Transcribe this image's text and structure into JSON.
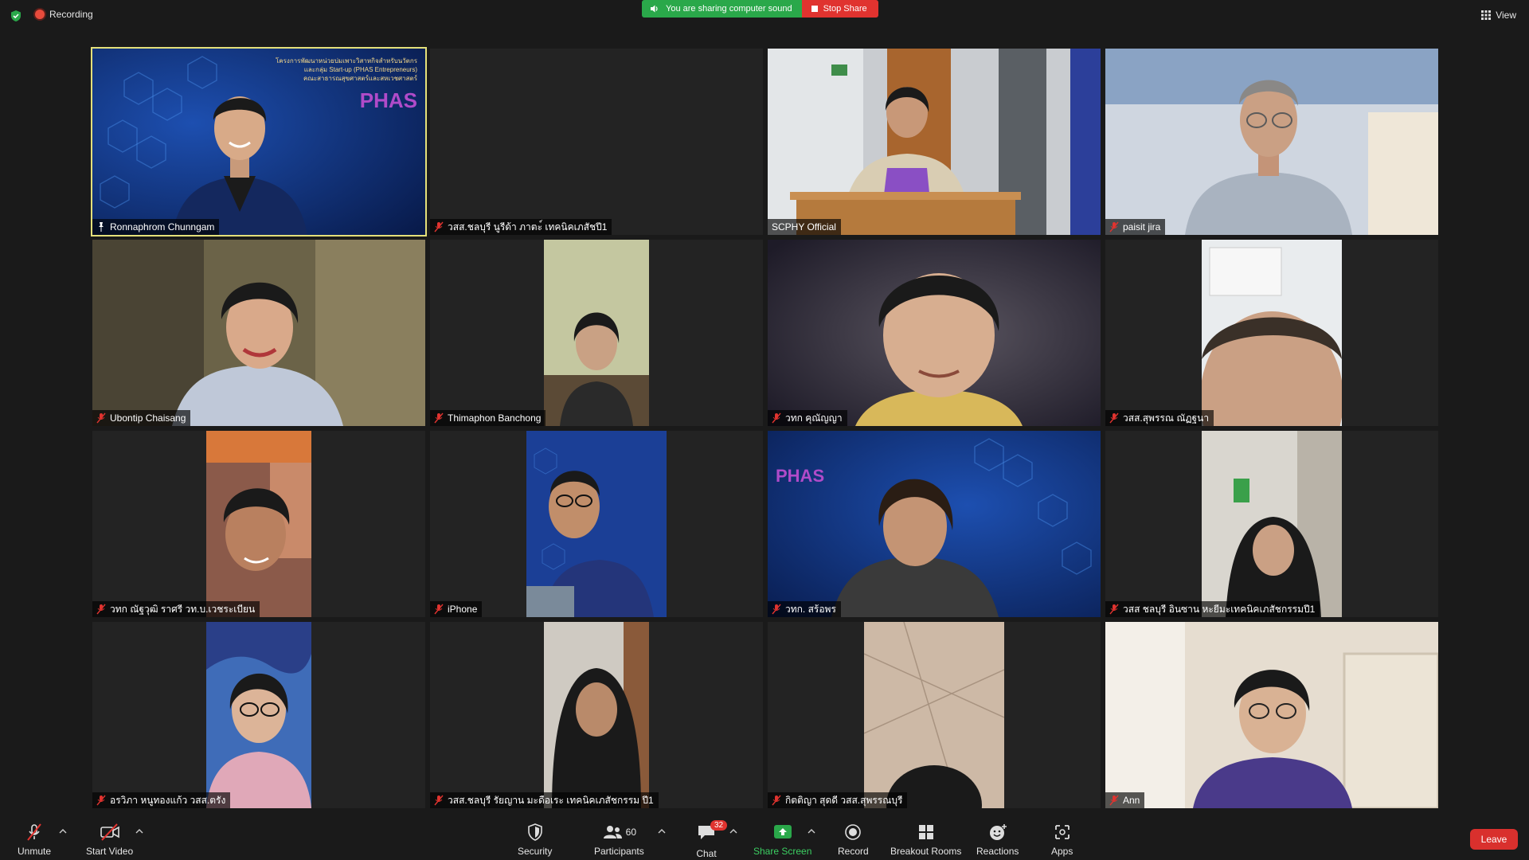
{
  "top": {
    "recording_label": "Recording",
    "sharing_sound_label": "You are sharing computer sound",
    "stop_share_label": "Stop Share",
    "view_label": "View"
  },
  "tiles": [
    {
      "name": "Ronnaphrom Chunngam",
      "pinned": true,
      "active": true
    },
    {
      "name": "วสส.ชลบุรี นูรีด้า ภาตะ์ เทคนิคเภสัชปี1"
    },
    {
      "name": "SCPHY Official"
    },
    {
      "name": "paisit jira"
    },
    {
      "name": "Ubontip Chaisang"
    },
    {
      "name": "Thimaphon Banchong"
    },
    {
      "name": "วทก คุณัญญา"
    },
    {
      "name": "วสส.สุพรรณ ณัฏฐนา"
    },
    {
      "name": "วทก ณัฐวุฒิ ราศรี วท.บ.เวชระเบียน"
    },
    {
      "name": "iPhone"
    },
    {
      "name": "วทก. สร้อพร"
    },
    {
      "name": "วสส ชลบุรี อินซาน หะยีมะเทคนิคเภสัชกรรมปี1"
    },
    {
      "name": "อรวิภา หนูทองแก้ว วสส.ตรัง"
    },
    {
      "name": "วสส.ชลบุรี รัยญาน มะดือเระ เทคนิคเภสัชกรรม ปี1"
    },
    {
      "name": "กิตติญา สุดดี วสส.สุพรรณบุรี"
    },
    {
      "name": "Ann"
    }
  ],
  "slide_text": {
    "line1": "โครงการพัฒนาหน่วยบ่มเพาะวิสาหกิจสำหรับนวัตกร",
    "line2": "และกลุ่ม Start-up (PHAS Entrepreneurs)",
    "line3": "คณะสาธารณสุขศาสตร์และสหเวชศาสตร์",
    "logo": "PHAS"
  },
  "toolbar": {
    "unmute": "Unmute",
    "start_video": "Start Video",
    "security": "Security",
    "participants": "Participants",
    "participants_count": "60",
    "chat": "Chat",
    "chat_badge": "32",
    "share_screen": "Share Screen",
    "record": "Record",
    "breakout": "Breakout Rooms",
    "reactions": "Reactions",
    "apps": "Apps",
    "leave": "Leave"
  },
  "colors": {
    "accent_green": "#2aa84a",
    "stop_red": "#e0332f",
    "active_speaker": "#e4e07a",
    "mute_red": "#e0332f"
  }
}
